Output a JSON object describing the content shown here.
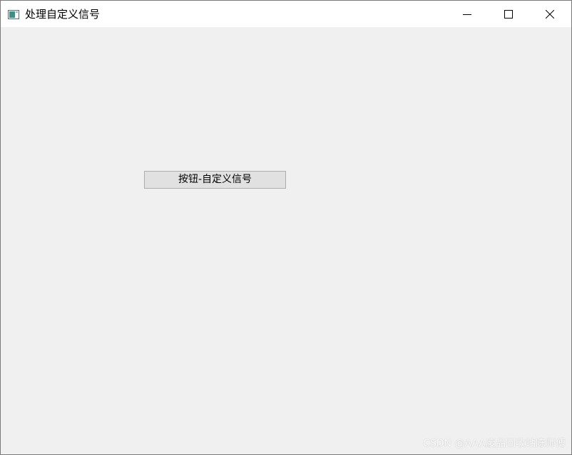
{
  "window": {
    "title": "处理自定义信号",
    "app_icon": "app-window-icon"
  },
  "caption_buttons": {
    "minimize_icon": "minimize-icon",
    "maximize_icon": "maximize-icon",
    "close_icon": "close-icon"
  },
  "main": {
    "button_label": "按钮-自定义信号"
  },
  "watermark": {
    "text": "CSDN @AAA废品回收站陈师傅"
  },
  "colors": {
    "client_background": "#f0f0f0",
    "titlebar_background": "#ffffff",
    "button_background": "#e1e1e1",
    "button_border": "#adadad"
  }
}
